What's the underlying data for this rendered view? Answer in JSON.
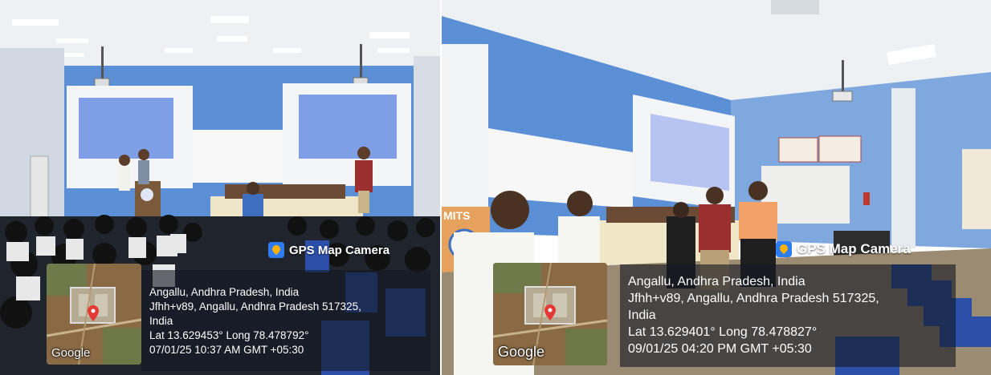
{
  "left": {
    "camera_label": "GPS Map Camera",
    "map_label": "Google",
    "place": "Angallu, Andhra Pradesh, India",
    "address_line1": "Jfhh+v89, Angallu, Andhra Pradesh 517325,",
    "address_line2": "India",
    "coords": "Lat 13.629453° Long 78.478792°",
    "timestamp": "07/01/25 10:37 AM GMT +05:30"
  },
  "right": {
    "camera_label": "GPS Map Camera",
    "map_label": "Google",
    "place": "Angallu, Andhra Pradesh, India",
    "address_line1": "Jfhh+v89, Angallu, Andhra Pradesh 517325,",
    "address_line2": "India",
    "coords": "Lat 13.629401° Long 78.478827°",
    "timestamp": "09/01/25 04:20 PM GMT +05:30"
  },
  "colors": {
    "wall_blue": "#5b8fd6",
    "ceiling": "#eef1f4",
    "info_overlay": "#141923",
    "pin_red": "#e53935"
  }
}
